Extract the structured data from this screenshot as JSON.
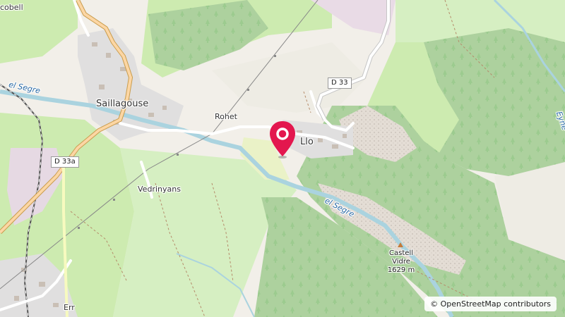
{
  "map": {
    "places": {
      "saillagouse": "Saillagouse",
      "llo": "Llo",
      "rohet": "Rohet",
      "vedrinyans": "Vedrinyans",
      "err": "Err",
      "osseja_fragment": "cobell"
    },
    "roads": {
      "d33": "D 33",
      "d33a": "D 33a"
    },
    "waterways": {
      "segre_upper": "el Segre",
      "segre_lower": "el Segre",
      "eyne_fragment": "Eyne"
    },
    "peak": {
      "name": "Castell Vidre",
      "elevation": "1629 m"
    },
    "attribution": {
      "symbol": "©",
      "text": "OpenStreetMap contributors"
    },
    "marker": {
      "icon": "map-pin-icon",
      "color": "#e3174e"
    }
  }
}
